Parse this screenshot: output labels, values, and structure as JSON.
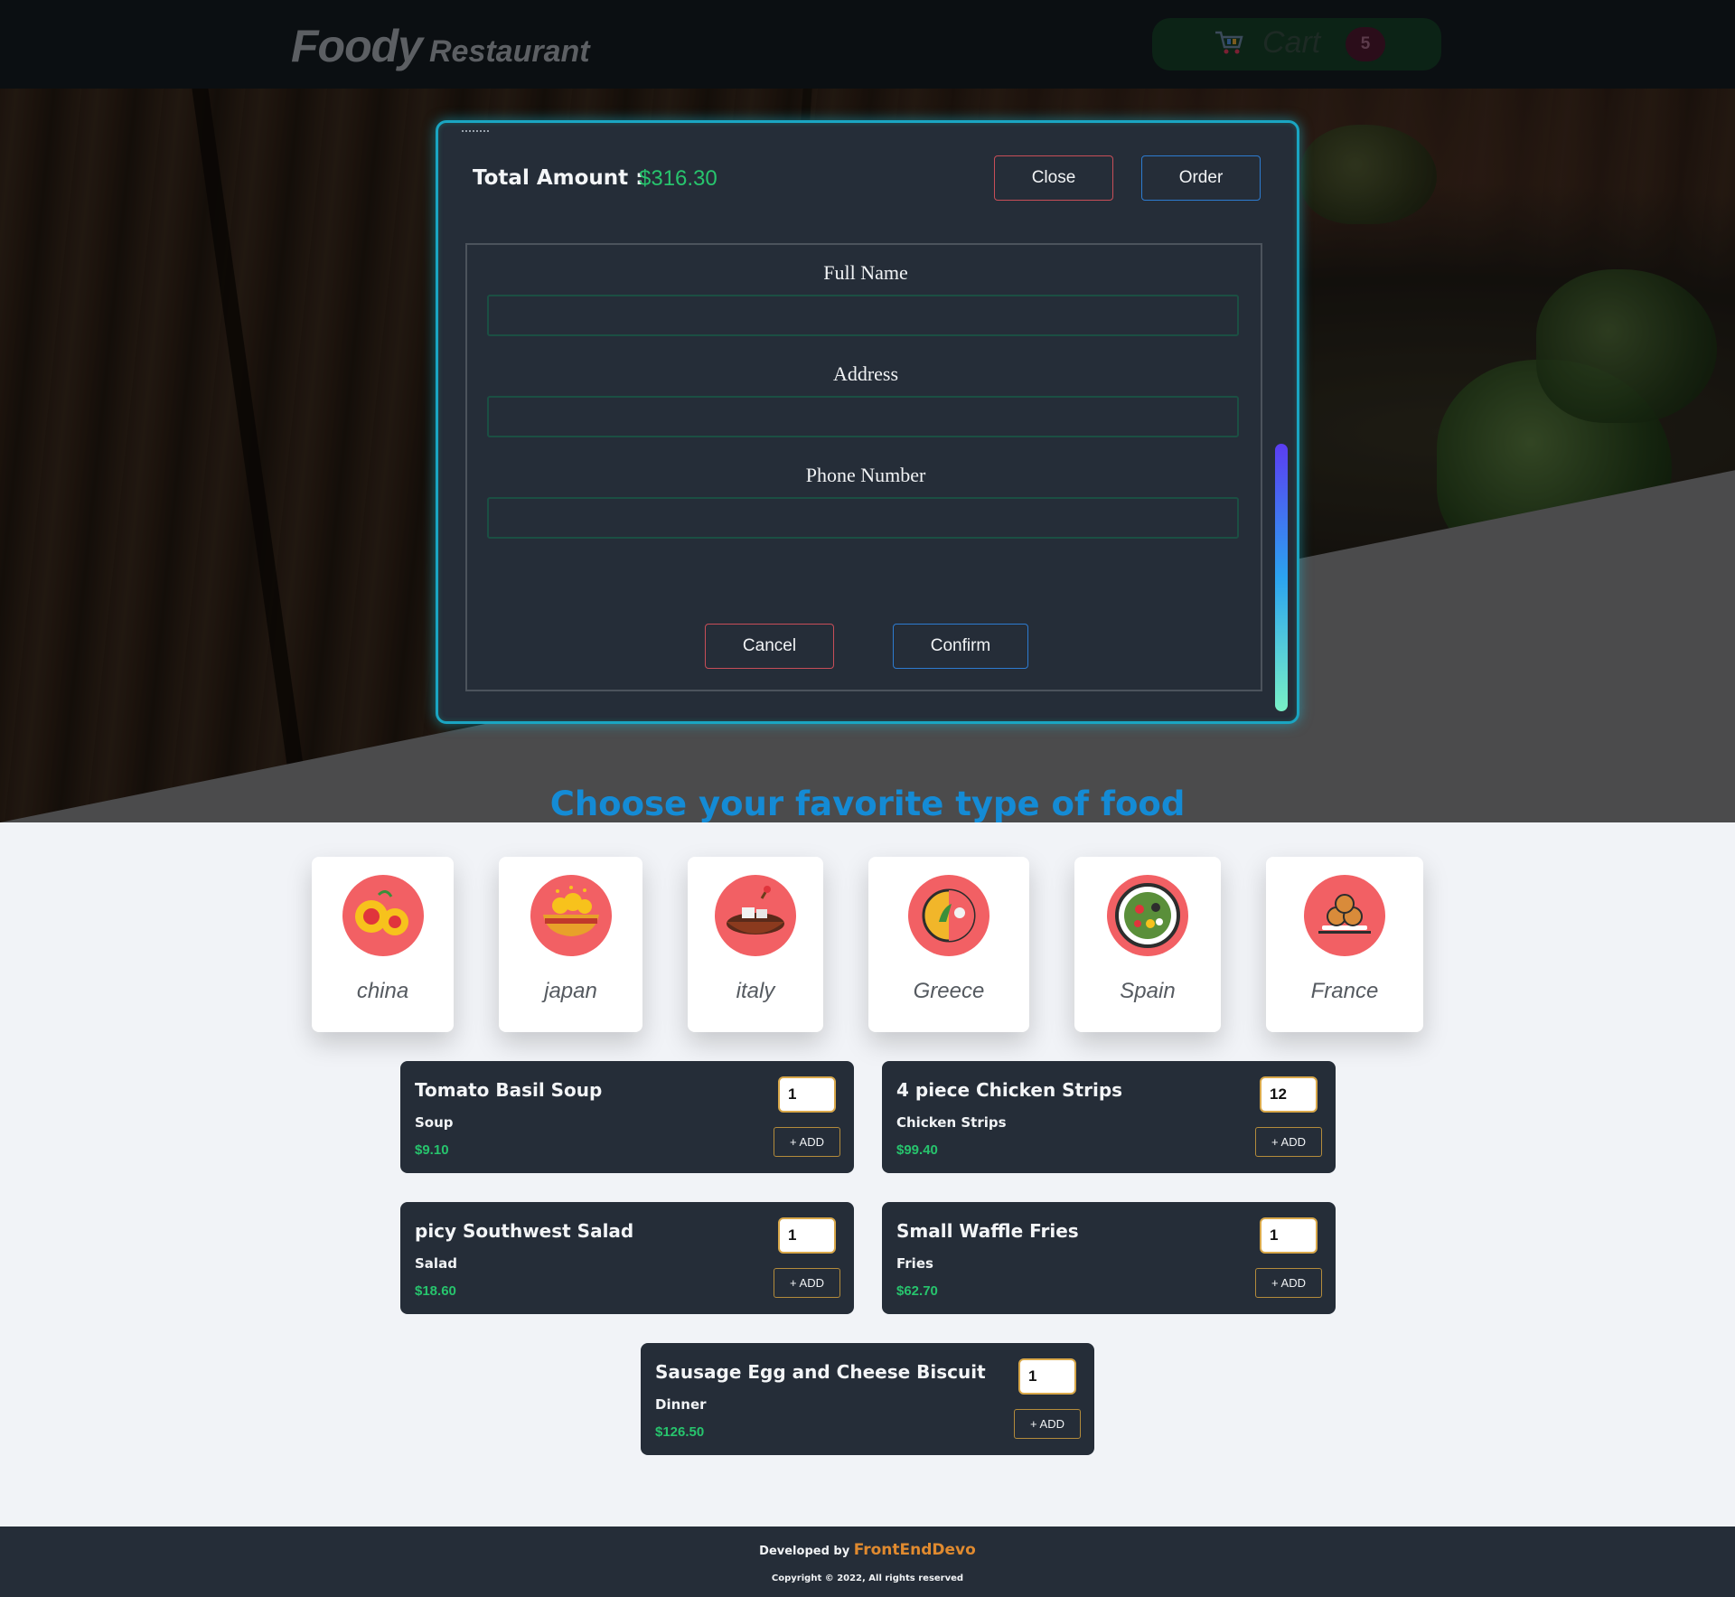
{
  "header": {
    "logo_main": "Foody",
    "logo_sub": "Restaurant",
    "cart_label": "Cart",
    "cart_count": "5",
    "cart_icon": "cart-icon"
  },
  "modal": {
    "total_label": "Total Amount :",
    "total_value": "$316.30",
    "close_label": "Close",
    "order_label": "Order",
    "form": {
      "full_name_label": "Full Name",
      "full_name_value": "",
      "address_label": "Address",
      "address_value": "",
      "phone_label": "Phone Number",
      "phone_value": "",
      "cancel_label": "Cancel",
      "confirm_label": "Confirm"
    }
  },
  "section_title": "Choose your favorite type of food",
  "categories": [
    {
      "label": "china",
      "icon": "china-food-icon"
    },
    {
      "label": "japan",
      "icon": "japan-food-icon"
    },
    {
      "label": "italy",
      "icon": "italy-food-icon"
    },
    {
      "label": "Greece",
      "icon": "greece-food-icon"
    },
    {
      "label": "Spain",
      "icon": "spain-food-icon"
    },
    {
      "label": "France",
      "icon": "france-food-icon"
    }
  ],
  "foods": [
    {
      "name": "Tomato Basil Soup",
      "category": "Soup",
      "price": "$9.10",
      "qty": "1",
      "add_label": "+ ADD"
    },
    {
      "name": "4 piece Chicken Strips",
      "category": "Chicken Strips",
      "price": "$99.40",
      "qty": "12",
      "add_label": "+ ADD"
    },
    {
      "name": "picy Southwest Salad",
      "category": "Salad",
      "price": "$18.60",
      "qty": "1",
      "add_label": "+ ADD"
    },
    {
      "name": "Small Waffle Fries",
      "category": "Fries",
      "price": "$62.70",
      "qty": "1",
      "add_label": "+ ADD"
    },
    {
      "name": "Sausage Egg and Cheese Biscuit",
      "category": "Dinner",
      "price": "$126.50",
      "qty": "1",
      "add_label": "+ ADD"
    }
  ],
  "footer": {
    "developed_by": "Developed by",
    "brand": "FrontEndDevo",
    "copyright": "Copyright © 2022, All rights reserved"
  },
  "colors": {
    "accent_blue": "#148bd5",
    "price_green": "#27c46d",
    "card_dark": "#252d38",
    "brand_orange": "#e08a2f",
    "category_red": "#f26064"
  }
}
